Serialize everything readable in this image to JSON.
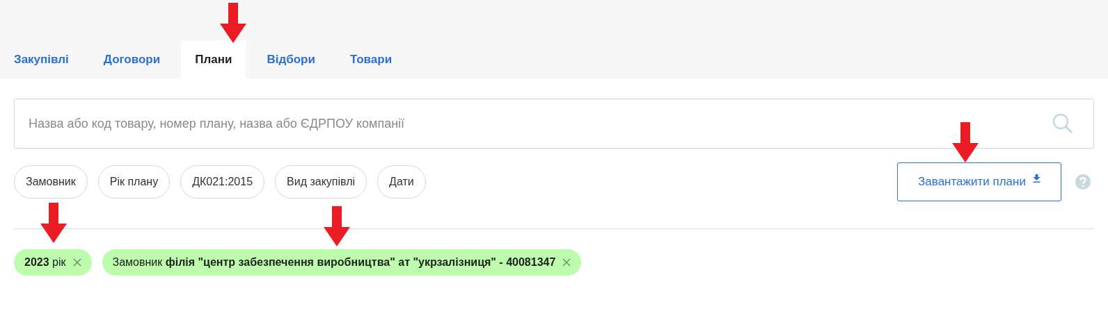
{
  "tabs": [
    {
      "label": "Закупівлі",
      "selected": false
    },
    {
      "label": "Договори",
      "selected": false
    },
    {
      "label": "Плани",
      "selected": true
    },
    {
      "label": "Відбори",
      "selected": false
    },
    {
      "label": "Товари",
      "selected": false
    }
  ],
  "search": {
    "placeholder": "Назва або код товару, номер плану, назва або ЄДРПОУ компанії"
  },
  "filters": [
    "Замовник",
    "Рік плану",
    "ДК021:2015",
    "Вид закупівлі",
    "Дати"
  ],
  "download_button": {
    "label": "Завантажити плани"
  },
  "active_filters": [
    {
      "text": "**2023** рік"
    },
    {
      "text": "Замовник **філія \"центр забезпечення виробництва\" ат \"укрзалізниця\" - 40081347**"
    }
  ]
}
